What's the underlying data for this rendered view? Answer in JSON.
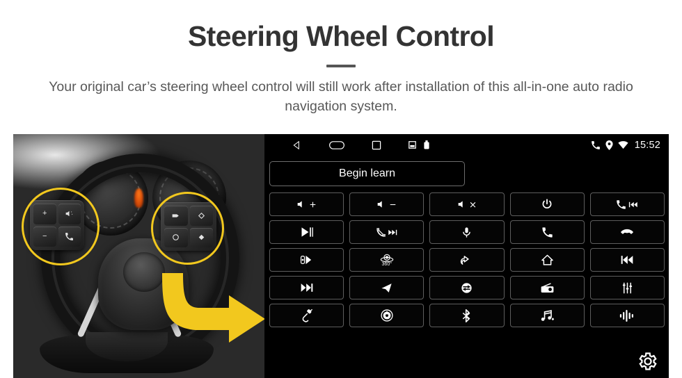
{
  "header": {
    "title": "Steering Wheel Control",
    "subtitle": "Your original car’s steering wheel control will still work after installation of this all-in-one auto radio navigation system."
  },
  "photo": {
    "alt": "car-steering-wheel-with-highlighted-control-clusters",
    "highlight_color": "#f2c81e",
    "arrow_color": "#f2c81e",
    "left_cluster_keys": [
      "volume-up",
      "mute-voice",
      "volume-down",
      "phone-call"
    ],
    "right_cluster_keys": [
      "media-source",
      "arrow-up",
      "circle-ok",
      "arrow-down"
    ]
  },
  "head_unit": {
    "status_bar": {
      "nav_icons": [
        "back-icon",
        "home-icon",
        "recents-icon",
        "sd-card-icon",
        "usb-icon"
      ],
      "tray_icons": [
        "phone-icon",
        "location-icon",
        "wifi-icon"
      ],
      "clock": "15:52"
    },
    "begin_learn_label": "Begin learn",
    "settings_icon": "gear-icon",
    "buttons": [
      {
        "name": "volume-up-button",
        "icon": "speaker-plus-icon",
        "label": ""
      },
      {
        "name": "volume-down-button",
        "icon": "speaker-minus-icon",
        "label": ""
      },
      {
        "name": "mute-button",
        "icon": "speaker-mute-icon",
        "label": ""
      },
      {
        "name": "power-button",
        "icon": "power-icon",
        "label": ""
      },
      {
        "name": "phone-previous-button",
        "icon": "phone-previous-icon",
        "label": ""
      },
      {
        "name": "play-pause-button",
        "icon": "play-pause-icon",
        "label": ""
      },
      {
        "name": "hangup-next-button",
        "icon": "hangup-next-icon",
        "label": ""
      },
      {
        "name": "microphone-button",
        "icon": "microphone-icon",
        "label": ""
      },
      {
        "name": "answer-call-button",
        "icon": "phone-answer-icon",
        "label": ""
      },
      {
        "name": "end-call-button",
        "icon": "phone-hangup-icon",
        "label": ""
      },
      {
        "name": "parking-radar-button",
        "icon": "car-radar-icon",
        "label": ""
      },
      {
        "name": "camera-360-button",
        "icon": "camera-360-icon",
        "label": "360°"
      },
      {
        "name": "back-button",
        "icon": "back-arrow-icon",
        "label": ""
      },
      {
        "name": "home-button",
        "icon": "house-icon",
        "label": ""
      },
      {
        "name": "previous-track-button",
        "icon": "previous-track-icon",
        "label": ""
      },
      {
        "name": "next-track-button",
        "icon": "next-track-icon",
        "label": ""
      },
      {
        "name": "navigation-button",
        "icon": "navigation-arrow-icon",
        "label": ""
      },
      {
        "name": "source-switch-button",
        "icon": "source-switch-icon",
        "label": ""
      },
      {
        "name": "radio-button",
        "icon": "radio-icon",
        "label": ""
      },
      {
        "name": "equalizer-button",
        "icon": "equalizer-icon",
        "label": ""
      },
      {
        "name": "aux-button",
        "icon": "aux-cable-icon",
        "label": ""
      },
      {
        "name": "disc-button",
        "icon": "disc-icon",
        "label": ""
      },
      {
        "name": "bluetooth-button",
        "icon": "bluetooth-icon",
        "label": ""
      },
      {
        "name": "bluetooth-music-button",
        "icon": "bluetooth-music-icon",
        "label": ""
      },
      {
        "name": "voice-assistant-button",
        "icon": "voice-wave-icon",
        "label": ""
      }
    ]
  }
}
